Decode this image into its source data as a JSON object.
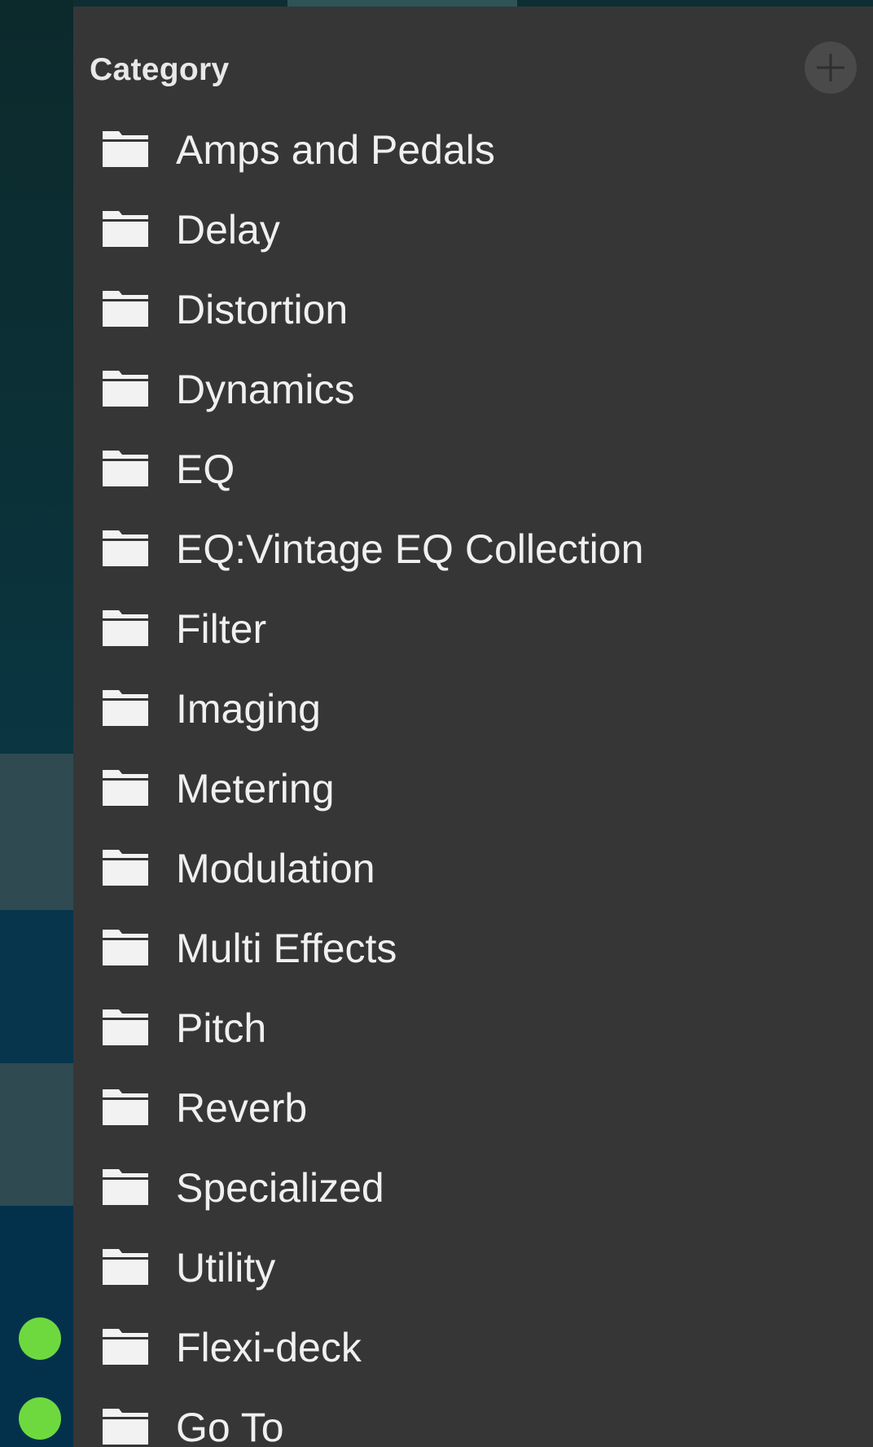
{
  "panel": {
    "header": "Category",
    "add_button_icon": "plus-circle-icon",
    "folder_icon": "folder-icon",
    "items": [
      {
        "label": "Amps and Pedals"
      },
      {
        "label": "Delay"
      },
      {
        "label": "Distortion"
      },
      {
        "label": "Dynamics"
      },
      {
        "label": "EQ"
      },
      {
        "label": "EQ:Vintage EQ Collection"
      },
      {
        "label": "Filter"
      },
      {
        "label": "Imaging"
      },
      {
        "label": "Metering"
      },
      {
        "label": "Modulation"
      },
      {
        "label": "Multi Effects"
      },
      {
        "label": "Pitch"
      },
      {
        "label": "Reverb"
      },
      {
        "label": "Specialized"
      },
      {
        "label": "Utility"
      },
      {
        "label": "Flexi-deck"
      },
      {
        "label": "Go To"
      }
    ]
  },
  "status_indicators": [
    {
      "icon": "green-status-dot",
      "color": "#6ed93f"
    },
    {
      "icon": "green-status-dot",
      "color": "#6ed93f"
    }
  ],
  "colors": {
    "panel_bg": "#363636",
    "text": "#f0f0f0",
    "status_green": "#6ed93f"
  }
}
